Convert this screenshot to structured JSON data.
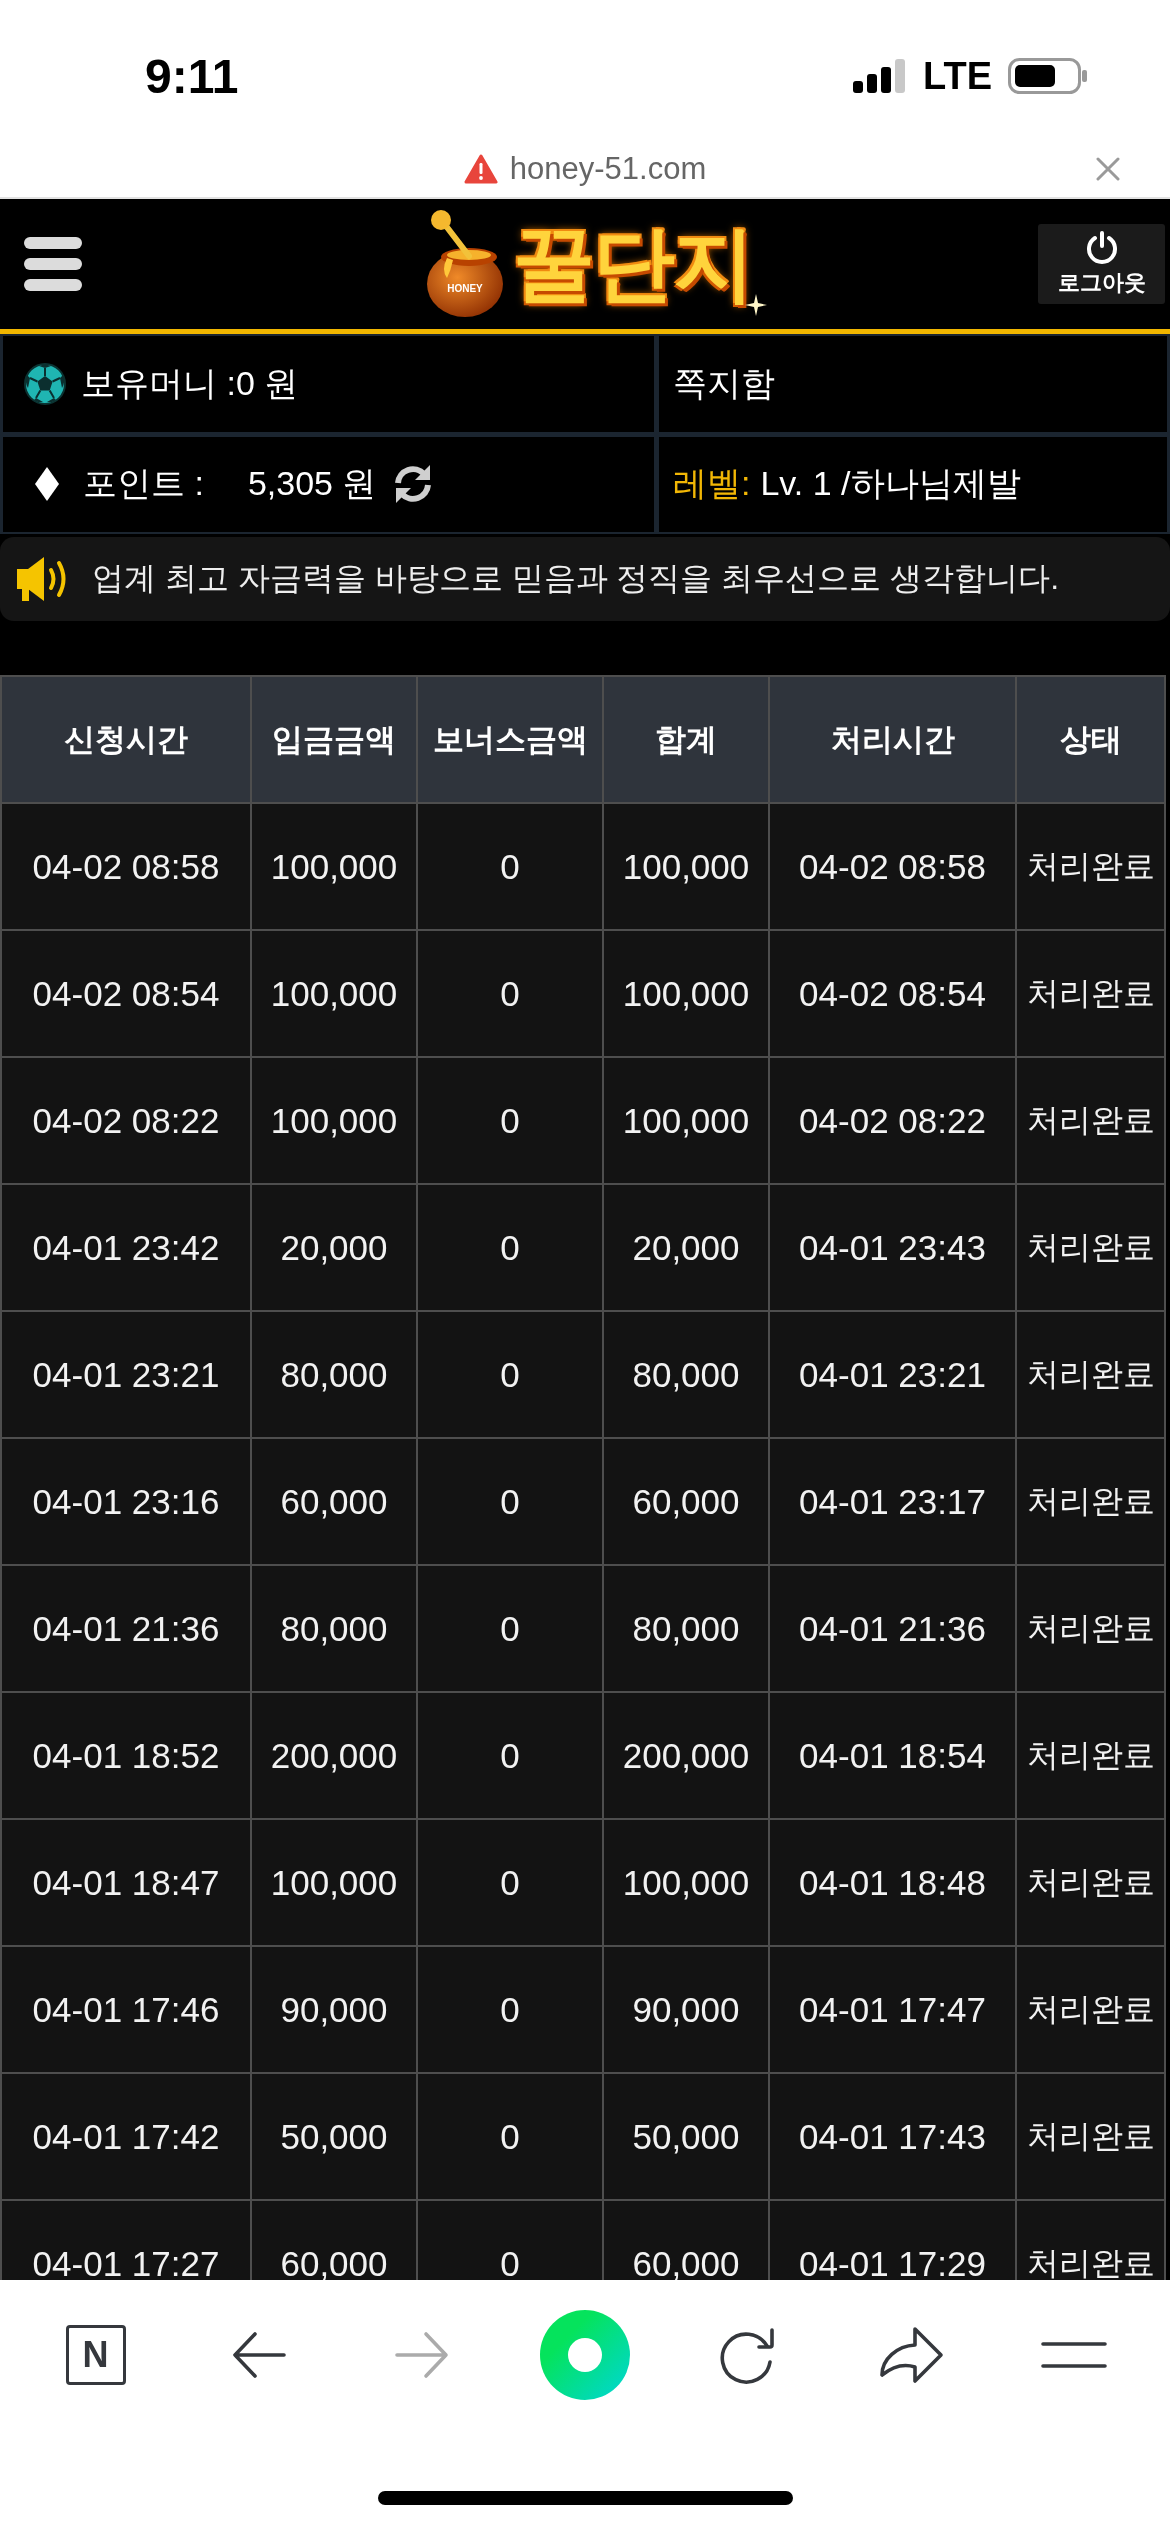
{
  "status_bar": {
    "time": "9:11",
    "network": "LTE"
  },
  "address_bar": {
    "url": "honey-51.com"
  },
  "header": {
    "logo": {
      "text": "꿀단지",
      "pot_label": "HONEY"
    },
    "logout_label": "로그아웃"
  },
  "account": {
    "money": "보유머니 :0 원",
    "messages": "쪽지함",
    "points_label": "포인트 :",
    "points_value": "5,305 원",
    "level_label": "레벨:",
    "level_value": "Lv. 1 /하나님제발"
  },
  "notice": "업계 최고 자금력을 바탕으로 믿음과 정직을 최우선으로 생각합니다.",
  "table": {
    "columns": [
      "신청시간",
      "입금금액",
      "보너스금액",
      "합계",
      "처리시간",
      "상태"
    ],
    "rows": [
      [
        "04-02 08:58",
        "100,000",
        "0",
        "100,000",
        "04-02 08:58",
        "처리완료"
      ],
      [
        "04-02 08:54",
        "100,000",
        "0",
        "100,000",
        "04-02 08:54",
        "처리완료"
      ],
      [
        "04-02 08:22",
        "100,000",
        "0",
        "100,000",
        "04-02 08:22",
        "처리완료"
      ],
      [
        "04-01 23:42",
        "20,000",
        "0",
        "20,000",
        "04-01 23:43",
        "처리완료"
      ],
      [
        "04-01 23:21",
        "80,000",
        "0",
        "80,000",
        "04-01 23:21",
        "처리완료"
      ],
      [
        "04-01 23:16",
        "60,000",
        "0",
        "60,000",
        "04-01 23:17",
        "처리완료"
      ],
      [
        "04-01 21:36",
        "80,000",
        "0",
        "80,000",
        "04-01 21:36",
        "처리완료"
      ],
      [
        "04-01 18:52",
        "200,000",
        "0",
        "200,000",
        "04-01 18:54",
        "처리완료"
      ],
      [
        "04-01 18:47",
        "100,000",
        "0",
        "100,000",
        "04-01 18:48",
        "처리완료"
      ],
      [
        "04-01 17:46",
        "90,000",
        "0",
        "90,000",
        "04-01 17:47",
        "처리완료"
      ],
      [
        "04-01 17:42",
        "50,000",
        "0",
        "50,000",
        "04-01 17:43",
        "처리완료"
      ],
      [
        "04-01 17:27",
        "60,000",
        "0",
        "60,000",
        "04-01 17:29",
        "처리완료"
      ]
    ]
  },
  "toolbar": {
    "items": [
      {
        "kind": "n-box",
        "label": "N",
        "disabled": false
      },
      {
        "kind": "back",
        "disabled": false
      },
      {
        "kind": "forward",
        "disabled": true
      },
      {
        "kind": "home",
        "disabled": false
      },
      {
        "kind": "reload",
        "disabled": false
      },
      {
        "kind": "share",
        "disabled": false
      },
      {
        "kind": "menu",
        "disabled": false
      }
    ]
  }
}
